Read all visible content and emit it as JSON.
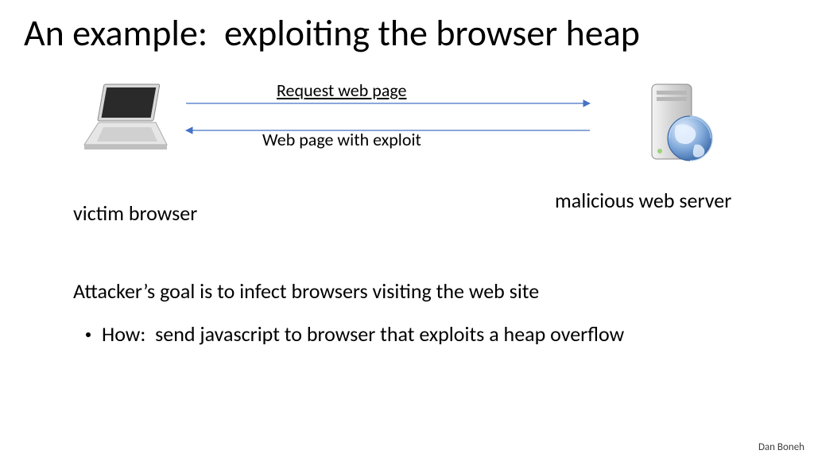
{
  "title": "An example:  exploiting the browser heap",
  "diagram": {
    "request_label": "Request web page",
    "response_label": "Web page with exploit",
    "victim_label": "victim browser",
    "server_label": "malicious web server"
  },
  "body": {
    "line1": "Attacker’s goal is to infect browsers visiting the web site",
    "bullet1": "How:  send javascript to browser that exploits a heap overflow"
  },
  "footer": "Dan Boneh",
  "arrow_color": "#4472c4"
}
